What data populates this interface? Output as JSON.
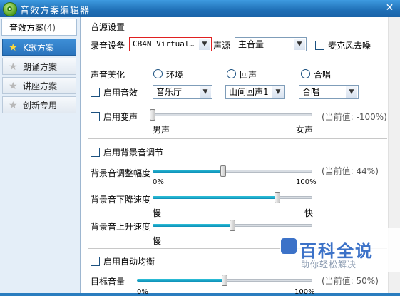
{
  "window": {
    "title": "音效方案编辑器",
    "close": "✕"
  },
  "left": {
    "header": {
      "label": "音效方案",
      "count": "(4)"
    },
    "items": [
      {
        "label": "K歌方案",
        "active": true
      },
      {
        "label": "朗诵方案",
        "active": false
      },
      {
        "label": "讲座方案",
        "active": false
      },
      {
        "label": "创新专用",
        "active": false
      }
    ]
  },
  "source": {
    "section_title": "音源设置",
    "device_label": "录音设备",
    "device_value": "CB4N Virtual…",
    "source_label": "声源",
    "source_value": "主音量",
    "noise_label": "麦克风去噪"
  },
  "beautify": {
    "section_title": "声音美化",
    "radio_env": "环境",
    "radio_echo": "回声",
    "radio_chorus": "合唱",
    "enable_effect": "启用音效",
    "env_value": "音乐厅",
    "echo_value": "山间回声1",
    "chorus_value": "合唱",
    "enable_voice": "启用变声",
    "voice_current": "(当前值: -100%)",
    "voice_min": "男声",
    "voice_max": "女声",
    "voice_level": 0
  },
  "background": {
    "enable_label": "启用背景音调节",
    "adjust_label": "背景音调整幅度",
    "adjust_current": "(当前值: 44%)",
    "adjust_min": "0%",
    "adjust_max": "100%",
    "adjust_level": 0.44,
    "down_label": "背景音下降速度",
    "down_min": "慢",
    "down_max": "快",
    "down_level": 0.78,
    "up_label": "背景音上升速度",
    "up_min": "慢",
    "up_level": 0.5
  },
  "auto": {
    "enable_label": "启用自动均衡",
    "target_label": "目标音量",
    "target_current": "(当前值: 50%)",
    "target_min": "0%",
    "target_max": "100%",
    "target_level": 0.5
  },
  "watermark": {
    "title": "百科全说",
    "sub": "助你轻松解决"
  }
}
